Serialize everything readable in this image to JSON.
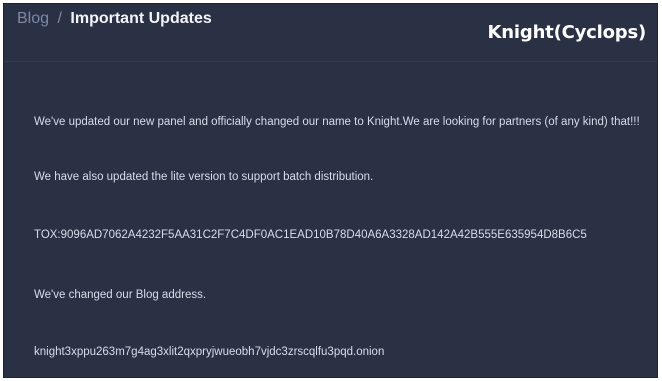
{
  "breadcrumb": {
    "parent": "Blog",
    "separator": "/",
    "current": "Important Updates"
  },
  "brand": {
    "name": "Knight(Cyclops)"
  },
  "post": {
    "lines": [
      "We've updated our new panel and officially changed our name to Knight.We are looking for partners (of any kind) that!!!",
      "We have also updated the lite version to support batch distribution.",
      "TOX:9096AD7062A4232F5AA31C2F7C4DF0AC1EAD10B78D40A6A3328AD142A42B555E635954D8B6C5",
      "We've changed our Blog address.",
      "knight3xppu263m7g4ag3xlit2qxpryjwueobh7vjdc3zrscqlfu3pqd.onion"
    ]
  },
  "colors": {
    "panel_bg": "#2b3144",
    "crumb_muted": "#7c88a8",
    "heading": "#f2f4fa",
    "body_text": "#d7dcea"
  }
}
